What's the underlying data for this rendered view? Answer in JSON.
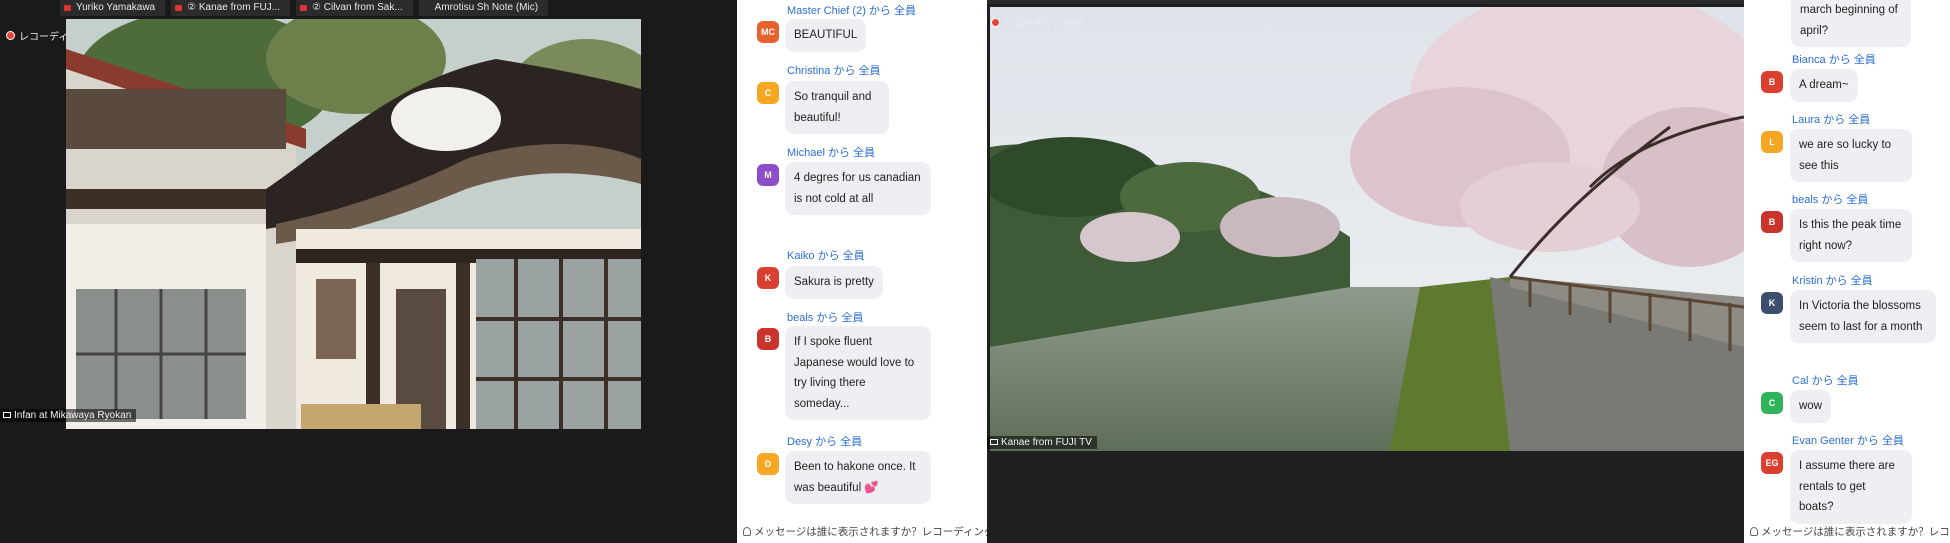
{
  "top_tabs": [
    {
      "label": "Yuriko Yamakawa"
    },
    {
      "label": "② Kanae from FUJ..."
    },
    {
      "label": "② Cilvan from Sak..."
    },
    {
      "label": "Amrotisu Sh Note (Mic)"
    }
  ],
  "left_video": {
    "recording_label": "レコーディング",
    "participant_label": "Infan at Mikawaya Ryokan"
  },
  "middle_video": {
    "recording_label": "レコーディング中",
    "participant_label": "Kanae from FUJI TV"
  },
  "chat_left": {
    "messages": [
      {
        "sender": "Master Chief (2)",
        "to": "から 全員",
        "initials": "MC",
        "color": "#e8622d",
        "text": "BEAUTIFUL"
      },
      {
        "sender": "Christina",
        "to": "から 全員",
        "initials": "C",
        "color": "#f5a623",
        "text": "So tranquil and beautiful!"
      },
      {
        "sender": "Michael",
        "to": "から 全員",
        "initials": "M",
        "color": "#8e4cc9",
        "text": "4 degres for us canadian is not cold at all"
      },
      {
        "sender": "Kaiko",
        "to": "から 全員",
        "initials": "K",
        "color": "#d9402f",
        "text": "Sakura is pretty"
      },
      {
        "sender": "beals",
        "to": "から 全員",
        "initials": "B",
        "color": "#c9352b",
        "text": "If I spoke fluent Japanese would love to try living there someday..."
      },
      {
        "sender": "Desy",
        "to": "から 全員",
        "initials": "D",
        "color": "#f5a623",
        "text": "Been to hakone once. It was beautiful 💕"
      }
    ],
    "footer": "メッセージは誰に表示されますか？レコーディングが..."
  },
  "chat_right": {
    "messages": [
      {
        "sender": "",
        "to": "",
        "initials": "",
        "color": "",
        "text": "march beginning of april?"
      },
      {
        "sender": "Bianca",
        "to": "から 全員",
        "initials": "B",
        "color": "#d9402f",
        "text": "A dream~"
      },
      {
        "sender": "Laura",
        "to": "から 全員",
        "initials": "L",
        "color": "#f5a623",
        "text": "we are so lucky to see this"
      },
      {
        "sender": "beals",
        "to": "から 全員",
        "initials": "B",
        "color": "#c9352b",
        "text": "Is this the peak time right now?"
      },
      {
        "sender": "Kristin",
        "to": "から 全員",
        "initials": "K",
        "color": "#3d4f6e",
        "text": "In Victoria the blossoms seem to last for a month"
      },
      {
        "sender": "Cal",
        "to": "から 全員",
        "initials": "C",
        "color": "#2fb35b",
        "text": "wow"
      },
      {
        "sender": "Evan Genter",
        "to": "から 全員",
        "initials": "EG",
        "color": "#d9402f",
        "text": "I assume there are rentals to get boats?"
      }
    ],
    "footer": "メッセージは誰に表示されますか？レコーディ..."
  }
}
